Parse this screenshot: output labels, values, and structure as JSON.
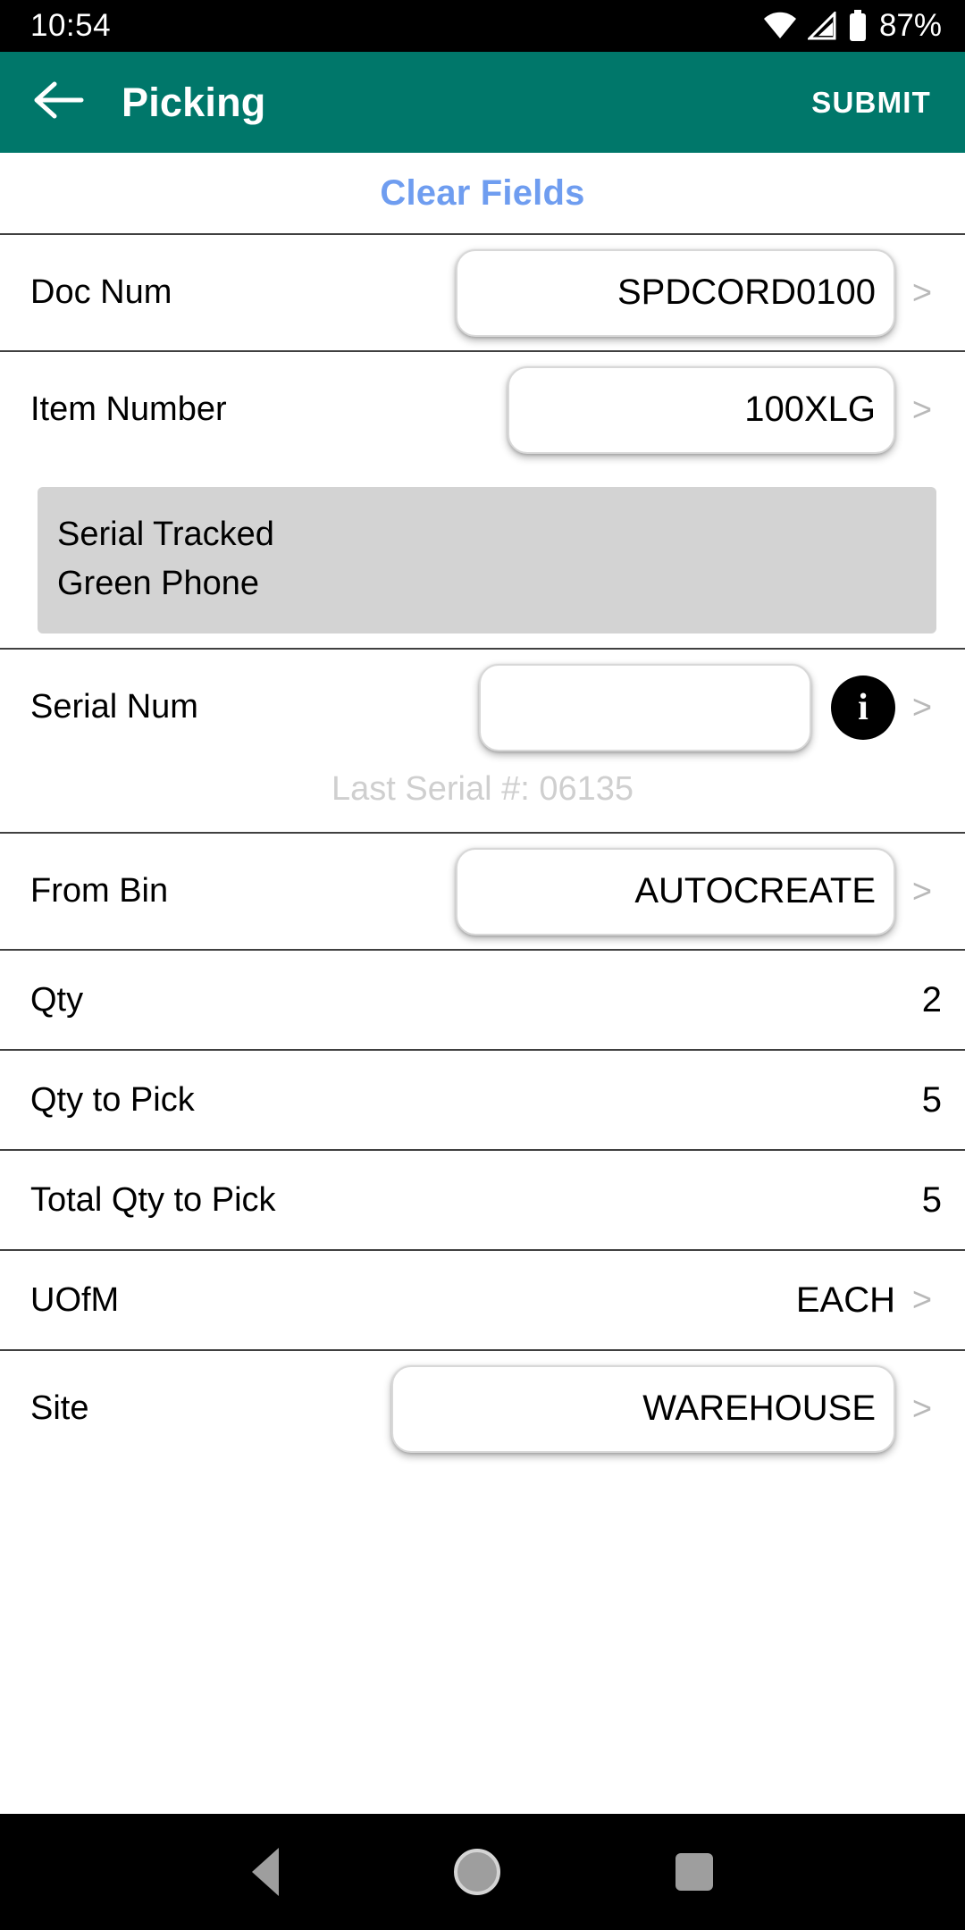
{
  "status_bar": {
    "time": "10:54",
    "battery_percent": "87%",
    "icons": [
      "wifi-icon",
      "cellular-signal-icon",
      "battery-icon"
    ]
  },
  "app_bar": {
    "back_icon": "arrow-left-icon",
    "title": "Picking",
    "submit_label": "SUBMIT",
    "background_color": "#00776a"
  },
  "actions": {
    "clear_fields_label": "Clear Fields",
    "clear_fields_color": "#6f9df0"
  },
  "form": {
    "doc_num": {
      "label": "Doc Num",
      "value": "SPDCORD0100",
      "chevron": ">"
    },
    "item_number": {
      "label": "Item Number",
      "value": "100XLG",
      "chevron": ">"
    },
    "item_info": {
      "line1": "Serial Tracked",
      "line2": "Green Phone",
      "background_color": "#d3d3d3"
    },
    "serial_num": {
      "label": "Serial Num",
      "value": "",
      "placeholder": "",
      "info_icon": "info-icon",
      "info_glyph": "i",
      "chevron": ">",
      "hint": "Last Serial #: 06135"
    },
    "from_bin": {
      "label": "From Bin",
      "value": "AUTOCREATE",
      "chevron": ">"
    },
    "qty": {
      "label": "Qty",
      "value": "2"
    },
    "qty_to_pick": {
      "label": "Qty to Pick",
      "value": "5"
    },
    "total_qty_to_pick": {
      "label": "Total Qty to Pick",
      "value": "5"
    },
    "uofm": {
      "label": "UOfM",
      "value": "EACH",
      "chevron": ">"
    },
    "site": {
      "label": "Site",
      "value": "WAREHOUSE",
      "chevron": ">"
    }
  },
  "nav_bar": {
    "back": "triangle-back-icon",
    "home": "circle-home-icon",
    "recents": "square-recents-icon"
  }
}
